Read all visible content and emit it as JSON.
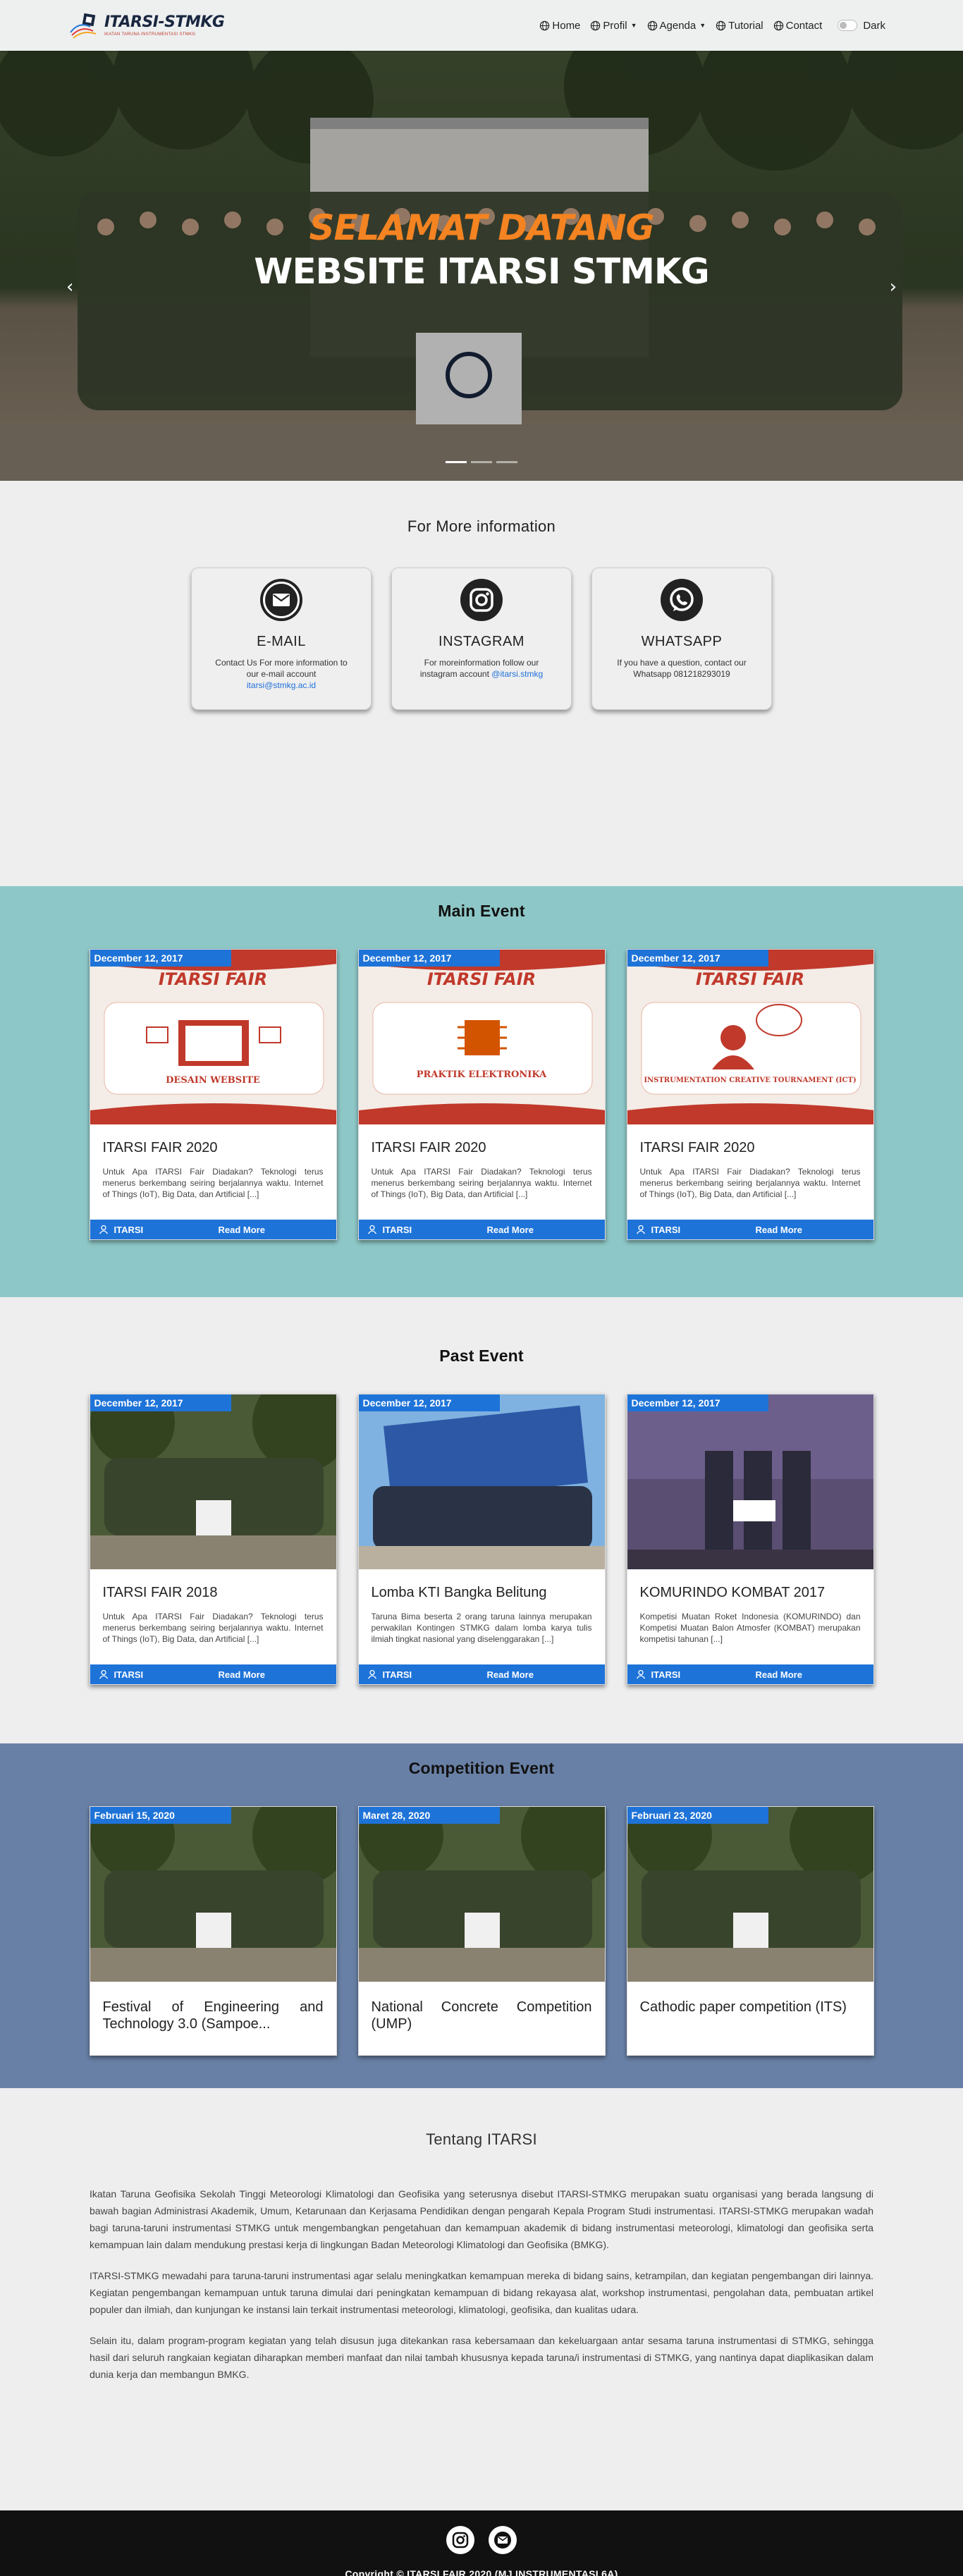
{
  "nav": {
    "brand_title": "ITARSI-STMKG",
    "brand_sub": "IKATAN TARUNA INSTRUMENTASI STMKG",
    "items": [
      {
        "label": "Home",
        "icon": "globe-icon"
      },
      {
        "label": "Profil",
        "icon": "globe-icon",
        "dropdown": true
      },
      {
        "label": "Agenda",
        "icon": "globe-icon",
        "dropdown": true
      },
      {
        "label": "Tutorial",
        "icon": "globe-icon"
      },
      {
        "label": "Contact",
        "icon": "globe-icon"
      }
    ],
    "dark_label": "Dark"
  },
  "hero": {
    "line1": "SELAMAT DATANG",
    "line2": "WEBSITE ITARSI STMKG",
    "prev": "‹",
    "next": "›",
    "slides": 3,
    "active_slide": 0
  },
  "info": {
    "title": "For More information",
    "cards": [
      {
        "title": "E-MAIL",
        "icon": "mail-icon",
        "text": "Contact Us For more information to our e-mail account ",
        "link": "itarsi@stmkg.ac.id"
      },
      {
        "title": "INSTAGRAM",
        "icon": "instagram-icon",
        "text": "For moreinformation follow our instagram account ",
        "link": "@itarsi.stmkg"
      },
      {
        "title": "WHATSAPP",
        "icon": "whatsapp-icon",
        "text": "If you have a question, contact our Whatsapp 081218293019",
        "link": ""
      }
    ]
  },
  "main_event": {
    "title": "Main Event",
    "cards": [
      {
        "date": "December 12, 2017",
        "title": "ITARSI FAIR 2020",
        "text": "Untuk Apa ITARSI Fair Diadakan? Teknologi terus menerus berkembang seiring berjalannya waktu. Internet of Things (IoT), Big Data, dan Artificial [...]",
        "author": "ITARSI",
        "read_more": "Read More",
        "poster_caption": "DESAIN WEBSITE",
        "poster_title": "ITARSI FAIR"
      },
      {
        "date": "December 12, 2017",
        "title": "ITARSI FAIR 2020",
        "text": "Untuk Apa ITARSI Fair Diadakan? Teknologi terus menerus berkembang seiring berjalannya waktu. Internet of Things (IoT), Big Data, dan Artificial [...]",
        "author": "ITARSI",
        "read_more": "Read More",
        "poster_caption": "PRAKTIK ELEKTRONIKA",
        "poster_title": "ITARSI FAIR"
      },
      {
        "date": "December 12, 2017",
        "title": "ITARSI FAIR 2020",
        "text": "Untuk Apa ITARSI Fair Diadakan? Teknologi terus menerus berkembang seiring berjalannya waktu. Internet of Things (IoT), Big Data, dan Artificial [...]",
        "author": "ITARSI",
        "read_more": "Read More",
        "poster_caption": "INSTRUMENTATION CREATIVE TOURNAMENT (ICT)",
        "poster_title": "ITARSI FAIR"
      }
    ]
  },
  "past_event": {
    "title": "Past Event",
    "cards": [
      {
        "date": "December 12, 2017",
        "title": "ITARSI FAIR 2018",
        "text": "Untuk Apa ITARSI Fair Diadakan? Teknologi terus menerus berkembang seiring berjalannya waktu. Internet of Things (IoT), Big Data, dan Artificial [...]",
        "author": "ITARSI",
        "read_more": "Read More"
      },
      {
        "date": "December 12, 2017",
        "title": "Lomba KTI Bangka Belitung",
        "text": "Taruna Bima beserta 2 orang taruna lainnya merupakan perwakilan Kontingen STMKG dalam lomba karya tulis ilmiah tingkat nasional yang diselenggarakan [...]",
        "author": "ITARSI",
        "read_more": "Read More"
      },
      {
        "date": "December 12, 2017",
        "title": "KOMURINDO KOMBAT 2017",
        "text": "Kompetisi Muatan Roket Indonesia (KOMURINDO) dan Kompetisi Muatan Balon Atmosfer (KOMBAT) merupakan kompetisi tahunan [...]",
        "author": "ITARSI",
        "read_more": "Read More"
      }
    ]
  },
  "competition_event": {
    "title": "Competition Event",
    "cards": [
      {
        "date": "Februari 15, 2020",
        "title": "Festival of Engineering and Technology 3.0 (Sampoe..."
      },
      {
        "date": "Maret 28, 2020",
        "title": "National Concrete Competition (UMP)"
      },
      {
        "date": "Februari 23, 2020",
        "title": "Cathodic paper competition (ITS)"
      }
    ]
  },
  "about": {
    "title": "Tentang ITARSI",
    "paragraphs": [
      "Ikatan Taruna Geofisika Sekolah Tinggi Meteorologi Klimatologi dan Geofisika yang seterusnya disebut ITARSI-STMKG merupakan suatu organisasi yang berada langsung di bawah bagian Administrasi Akademik, Umum, Ketarunaan dan Kerjasama Pendidikan dengan pengarah Kepala Program Studi instrumentasi. ITARSI-STMKG merupakan wadah bagi taruna-taruni instrumentasi STMKG untuk mengembangkan pengetahuan dan kemampuan akademik di bidang instrumentasi meteorologi, klimatologi dan geofisika serta kemampuan lain dalam mendukung prestasi kerja di lingkungan Badan Meteorologi Klimatologi dan Geofisika (BMKG).",
      "ITARSI-STMKG mewadahi para taruna-taruni instrumentasi agar selalu meningkatkan kemampuan mereka di bidang sains, ketrampilan, dan kegiatan pengembangan diri lainnya. Kegiatan pengembangan kemampuan untuk taruna dimulai dari peningkatan kemampuan di bidang rekayasa alat, workshop instrumentasi, pengolahan data, pembuatan artikel populer dan ilmiah, dan kunjungan ke instansi lain terkait instrumentasi meteorologi, klimatologi, geofisika, dan kualitas udara.",
      "Selain itu, dalam program-program kegiatan yang telah disusun juga ditekankan rasa kebersamaan dan kekeluargaan antar sesama taruna instrumentasi di STMKG, sehingga hasil dari seluruh rangkaian kegiatan diharapkan memberi manfaat dan nilai tambah khususnya kepada taruna/i instrumentasi di STMKG, yang nantinya dapat diaplikasikan dalam dunia kerja dan membangun BMKG."
    ]
  },
  "footer": {
    "icons": [
      "instagram-icon",
      "mail-icon"
    ],
    "copyright": "Copyright © ITARSI FAIR 2020 (MJ INSTRUMENTASI 6A)"
  },
  "colors": {
    "accent_blue": "#1e73d8",
    "main_bg": "#8ec7c7",
    "comp_bg": "#6980a6",
    "hero_orange": "#f48321"
  }
}
